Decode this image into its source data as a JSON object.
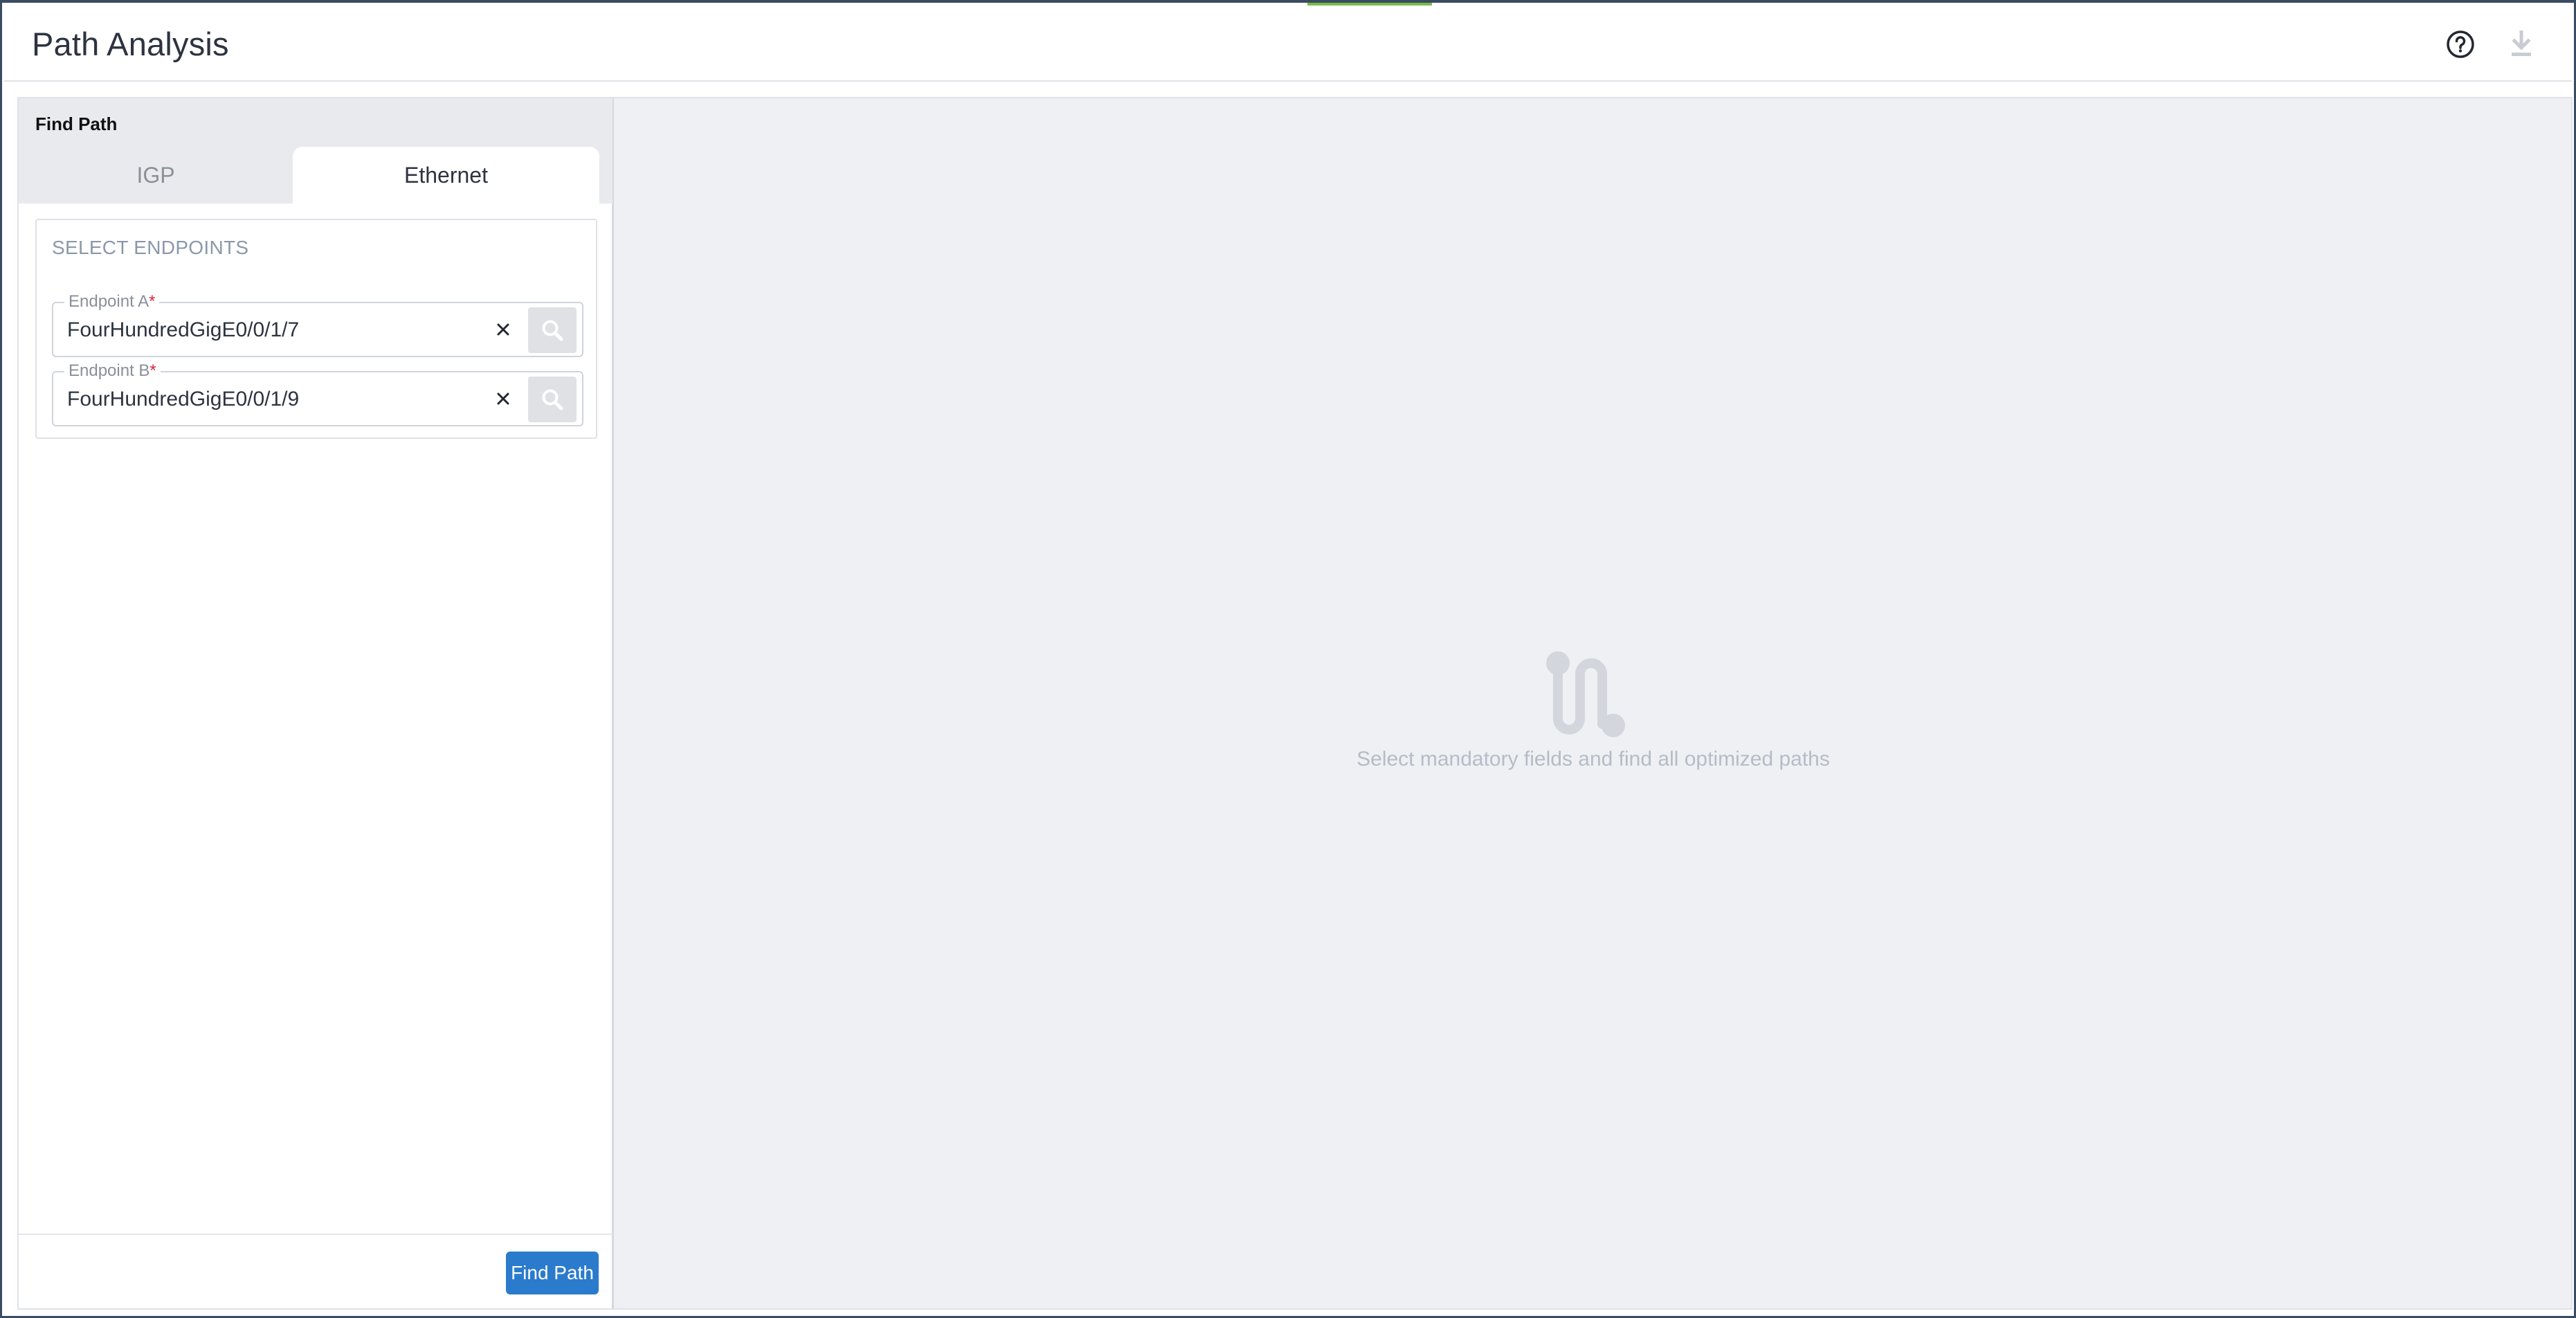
{
  "header": {
    "title": "Path Analysis",
    "help_icon": "help-circle-icon",
    "download_icon": "download-icon"
  },
  "left_panel": {
    "title": "Find Path",
    "tabs": [
      {
        "label": "IGP",
        "active": false
      },
      {
        "label": "Ethernet",
        "active": true
      }
    ],
    "section_label": "SELECT ENDPOINTS",
    "endpoint_a": {
      "label": "Endpoint A",
      "required_mark": "*",
      "value": "FourHundredGigE0/0/1/7"
    },
    "endpoint_b": {
      "label": "Endpoint B",
      "required_mark": "*",
      "value": "FourHundredGigE0/0/1/9"
    },
    "find_path_button": "Find Path"
  },
  "right_panel": {
    "empty_icon": "path-route-icon",
    "empty_message": "Select mandatory fields and find all optimized paths"
  },
  "colors": {
    "accent_green": "#79bd4a",
    "primary_button": "#2b7bcd",
    "required_red": "#d9233b"
  }
}
